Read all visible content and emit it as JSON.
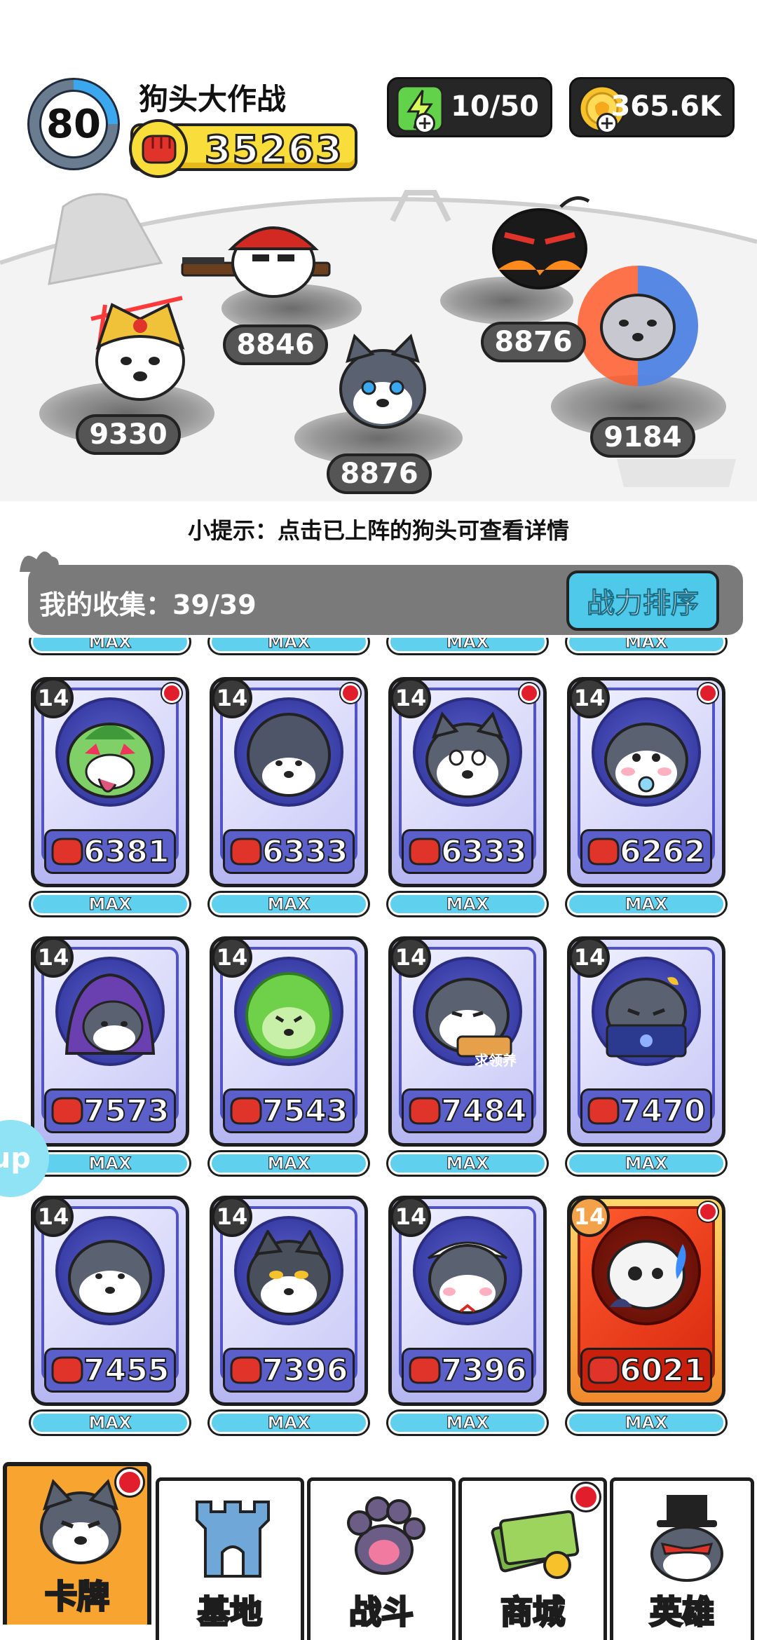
{
  "header": {
    "level": "80",
    "title": "狗头大作战",
    "power": "35263",
    "energy": "10/50",
    "coins": "365.6K"
  },
  "battlefield": {
    "heroes": [
      {
        "name": "golden-armor-dog",
        "power": "9330"
      },
      {
        "name": "soldier-dog",
        "power": "8846"
      },
      {
        "name": "husky-dog",
        "power": "8876"
      },
      {
        "name": "bomb-dog",
        "power": "8876"
      },
      {
        "name": "fire-ice-dog",
        "power": "9184"
      }
    ]
  },
  "tip": "小提示：点击已上阵的狗头可查看详情",
  "collection": {
    "label": "我的收集：39/39",
    "sort_button": "战力排序",
    "max_label": "MAX",
    "cards": [
      {
        "level": "14",
        "power": "6381",
        "avatar": "crazy-green-dog"
      },
      {
        "level": "14",
        "power": "6333",
        "avatar": "fluffy-dog"
      },
      {
        "level": "14",
        "power": "6333",
        "avatar": "smiling-dog"
      },
      {
        "level": "14",
        "power": "6262",
        "avatar": "pacifier-dog"
      },
      {
        "level": "14",
        "power": "7573",
        "avatar": "hooded-mage-dog"
      },
      {
        "level": "14",
        "power": "7543",
        "avatar": "cabbage-dog"
      },
      {
        "level": "14",
        "power": "7484",
        "avatar": "begging-dog"
      },
      {
        "level": "14",
        "power": "7470",
        "avatar": "laptop-dog"
      },
      {
        "level": "14",
        "power": "7455",
        "avatar": "plain-dog"
      },
      {
        "level": "14",
        "power": "7396",
        "avatar": "shiba-dog"
      },
      {
        "level": "14",
        "power": "7396",
        "avatar": "maid-dog"
      },
      {
        "level": "14",
        "power": "6021",
        "avatar": "skull-dog"
      }
    ],
    "begging_sign": "求领养"
  },
  "side_tab": "up",
  "nav": [
    {
      "label": "卡牌",
      "icon": "dog-face-icon"
    },
    {
      "label": "基地",
      "icon": "castle-icon"
    },
    {
      "label": "战斗",
      "icon": "paw-icon"
    },
    {
      "label": "商城",
      "icon": "money-icon"
    },
    {
      "label": "英雄",
      "icon": "top-hat-dog-icon"
    }
  ],
  "colors": {
    "accent": "#4ec9ea",
    "active_tab": "#f7a431",
    "badge": "#e11e2b"
  }
}
